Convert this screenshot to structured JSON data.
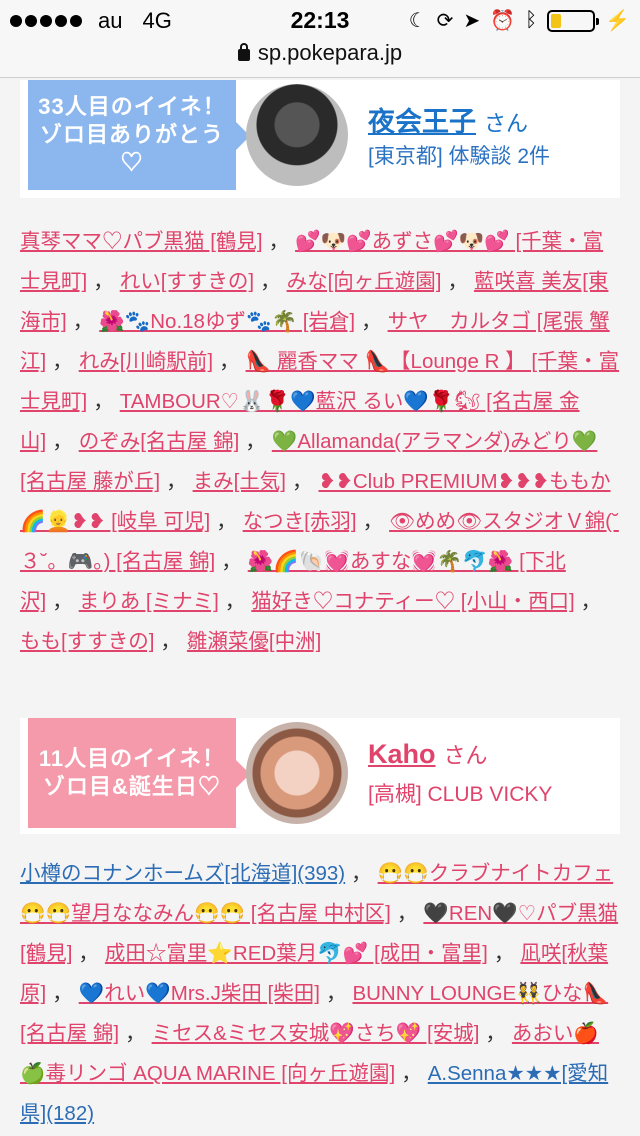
{
  "status_bar": {
    "carrier": "au",
    "network": "4G",
    "time": "22:13",
    "icons": [
      "moon-icon",
      "rotation-lock-icon",
      "location-icon",
      "alarm-icon",
      "bluetooth-icon",
      "battery-icon"
    ],
    "battery_level": 0.25,
    "battery_color": "#f3c318"
  },
  "url_bar": {
    "domain": "sp.pokepara.jp"
  },
  "cards": [
    {
      "badge": "33人目のイイネ！ゾロ目ありがとう♡",
      "badge_color": "#8cb7ee",
      "name": "夜会王子",
      "suffix": "さん",
      "meta": "[東京都] 体験談 2件"
    },
    {
      "badge": "11人目のイイネ！ゾロ目&誕生日♡",
      "badge_color": "#f59aab",
      "name": "Kaho",
      "suffix": "さん",
      "meta": "[高槻] CLUB VICKY"
    }
  ],
  "likes_1": [
    "真琴ママ♡パブ黒猫 [鶴見]",
    "💕🐶💕あずさ💕🐶💕 [千葉・富士見町]",
    "れい[すすきの]",
    "みな[向ヶ丘遊園]",
    "藍咲喜 美友[東海市]",
    "🌺🐾No.18ゆず🐾🌴 [岩倉]",
    "サヤ　カルタゴ [尾張 蟹江]",
    "れみ[川崎駅前]",
    "👠 麗香ママ 👠【Lounge R 】 [千葉・富士見町]",
    "TAMBOUR♡🐰🌹💙藍沢 るい💙🌹🐿 [名古屋 金山]",
    "のぞみ[名古屋 錦]",
    "💚Allamanda(アラマンダ)みどり💚 [名古屋 藤が丘]",
    "まみ[土気]",
    "❥❥Club PREMIUM❥❥❥ももか🌈👱❥❥ [岐阜 可児]",
    "なつき[赤羽]",
    "👁めめ👁スタジオＶ錦(˘３˘。🎮｡) [名古屋 錦]",
    "🌺🌈🐚💓あすな💓🌴🐬🌺 [下北沢]",
    "まりあ [ミナミ]",
    "猫好き♡コナティー♡ [小山・西口]",
    "もも[すすきの]",
    "雛瀬菜優[中洲]"
  ],
  "likes_2": [
    {
      "text": "小樽のコナンホームズ[北海道](393)",
      "color": "blue"
    },
    {
      "text": "😷😷クラブナイトカフェ😷😷望月ななみん😷😷 [名古屋 中村区]",
      "color": "pink"
    },
    {
      "text": "🖤REN🖤♡パブ黒猫 [鶴見]",
      "color": "pink"
    },
    {
      "text": "成田☆富里⭐RED葉月🐬💕 [成田・富里]",
      "color": "pink"
    },
    {
      "text": "凪咲[秋葉原]",
      "color": "pink"
    },
    {
      "text": "💙れい💙Mrs.J柴田 [柴田]",
      "color": "pink"
    },
    {
      "text": "BUNNY LOUNGE👯ひな👠 [名古屋 錦]",
      "color": "pink"
    },
    {
      "text": "ミセス&ミセス安城💖さち💖 [安城]",
      "color": "pink"
    },
    {
      "text": "あおい🍎🍏毒リンゴ AQUA MARINE [向ヶ丘遊園]",
      "color": "pink"
    },
    {
      "text": "A.Senna★★★[愛知県](182)",
      "color": "blue"
    }
  ]
}
